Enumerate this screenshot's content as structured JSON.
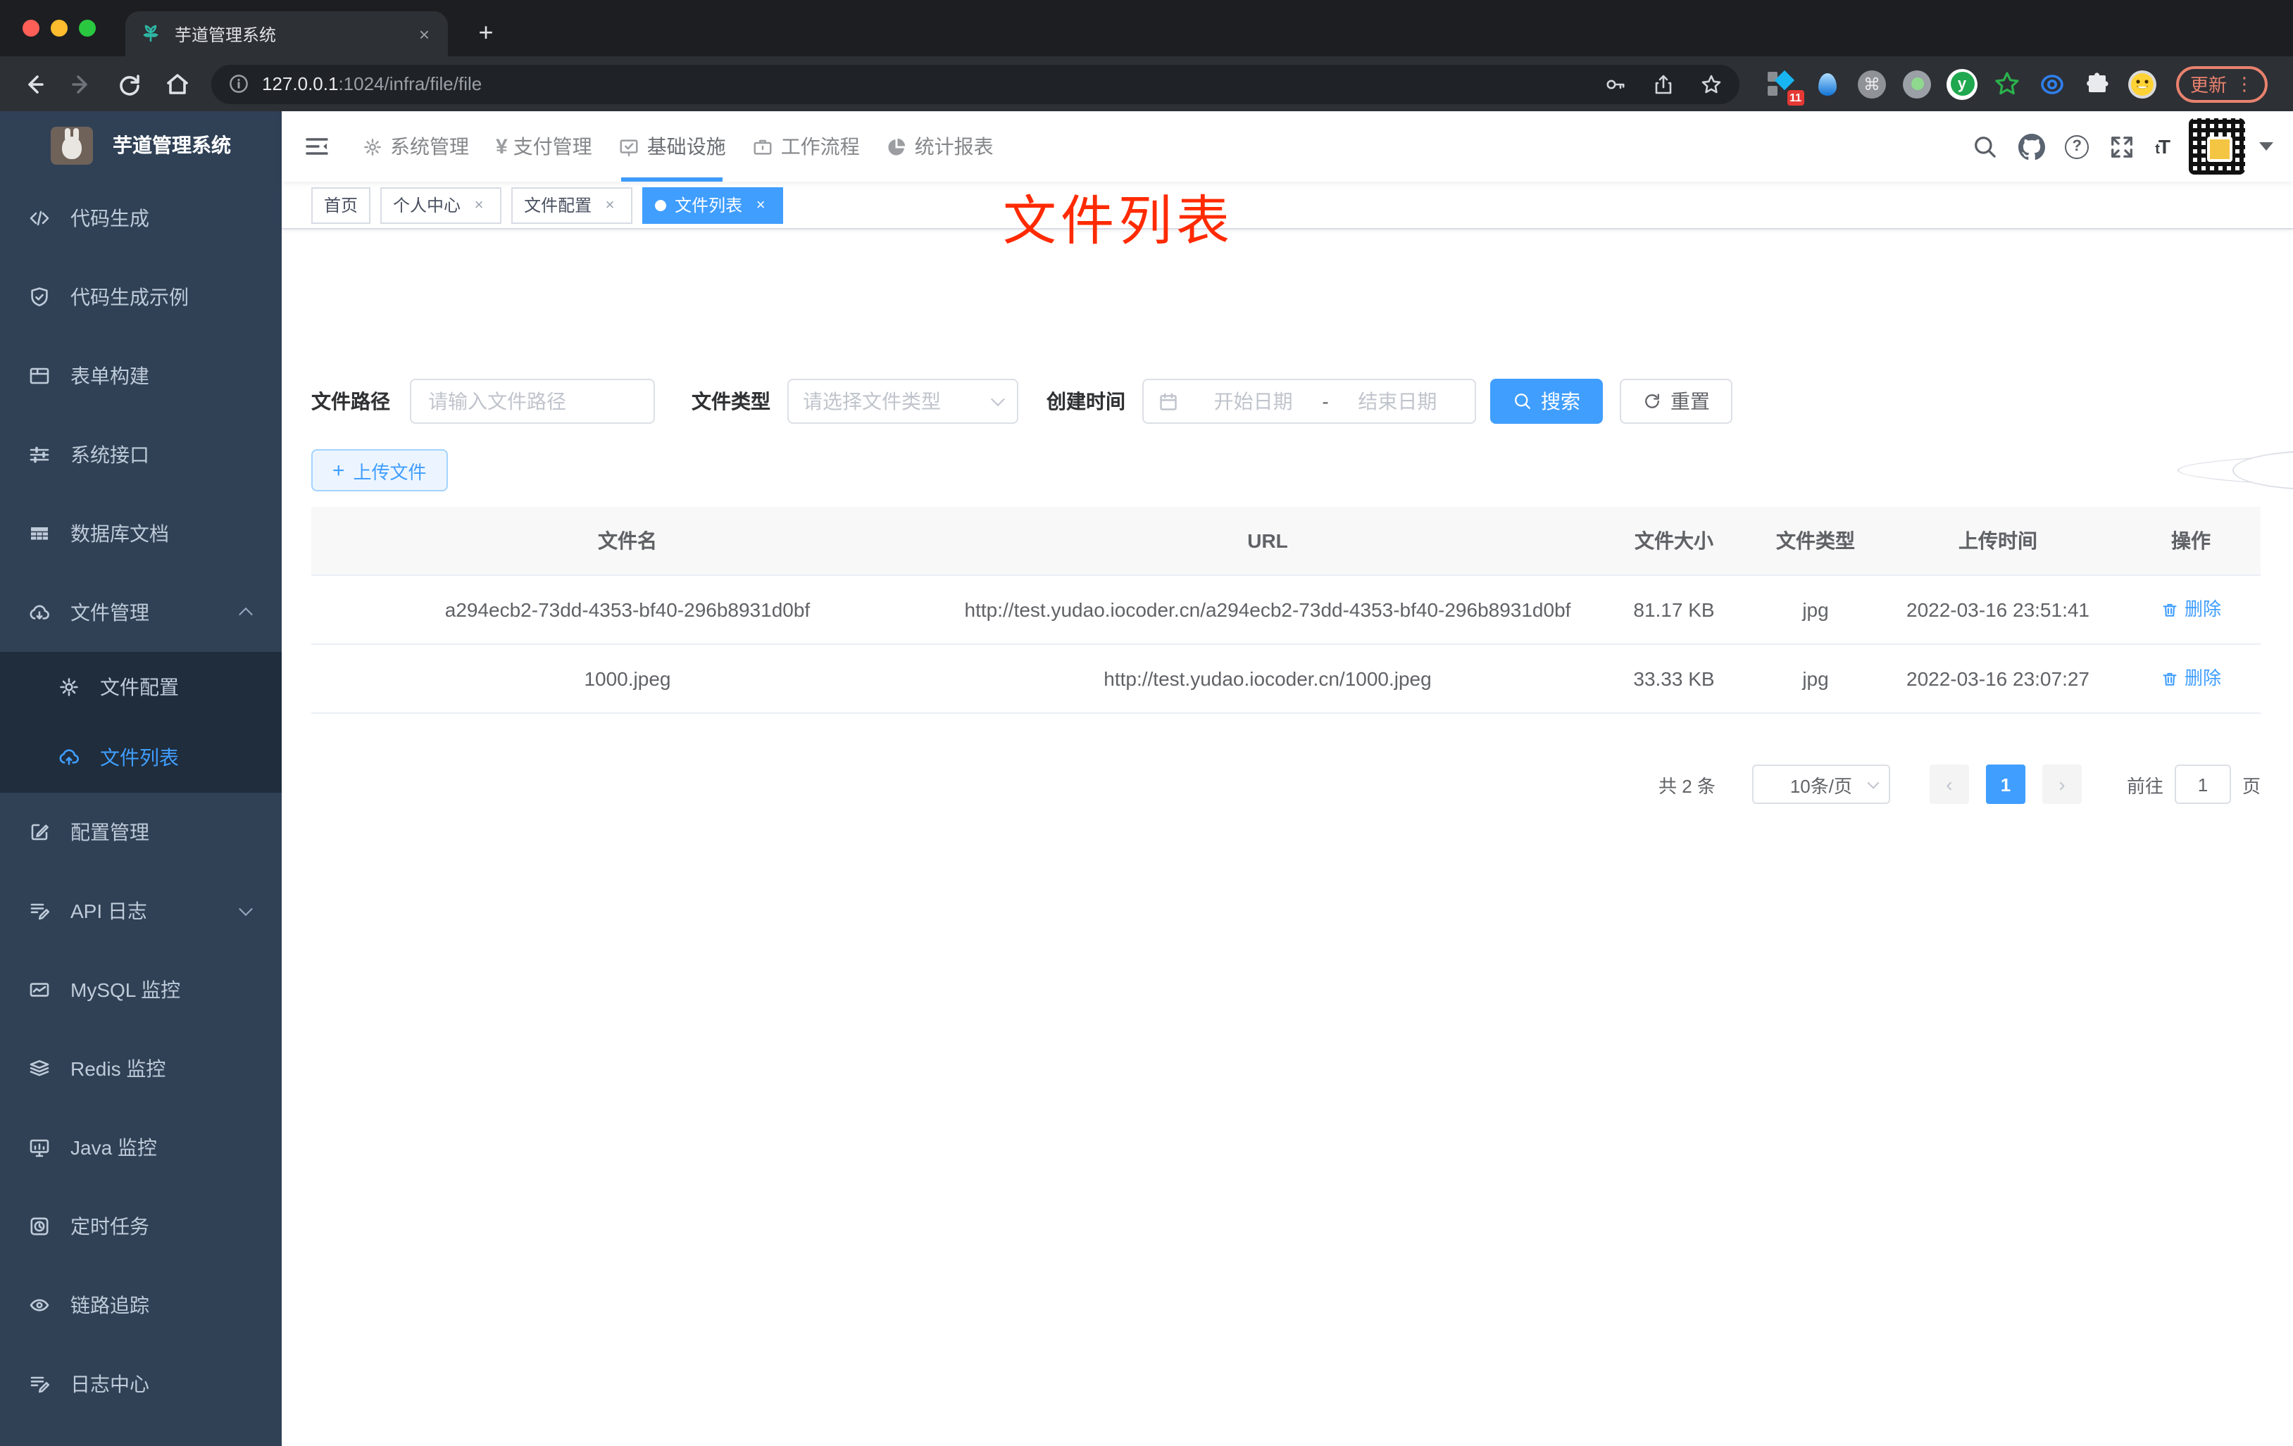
{
  "browser": {
    "tab_title": "芋道管理系统",
    "tab_close": "×",
    "new_tab": "+",
    "url_host": "127.0.0.1",
    "url_rest": ":1024/infra/file/file",
    "extension_badge": "11",
    "cmd_glyph": "⌘",
    "y_glyph": "y",
    "update_label": "更新",
    "kebab_glyph": "⋮"
  },
  "sidebar": {
    "logo_title": "芋道管理系统",
    "items": [
      {
        "label": "代码生成",
        "icon": "code-icon"
      },
      {
        "label": "代码生成示例",
        "icon": "shield-check-icon"
      },
      {
        "label": "表单构建",
        "icon": "form-icon"
      },
      {
        "label": "系统接口",
        "icon": "sliders-icon"
      },
      {
        "label": "数据库文档",
        "icon": "table-grid-icon"
      },
      {
        "label": "文件管理",
        "icon": "cloud-download-icon",
        "expanded": true
      },
      {
        "label": "文件配置",
        "icon": "gear-icon",
        "submenu": true
      },
      {
        "label": "文件列表",
        "icon": "cloud-upload-icon",
        "submenu": true,
        "active": true
      },
      {
        "label": "配置管理",
        "icon": "edit-square-icon"
      },
      {
        "label": "API 日志",
        "icon": "log-edit-icon",
        "collapsed": true
      },
      {
        "label": "MySQL 监控",
        "icon": "chart-line-icon"
      },
      {
        "label": "Redis 监控",
        "icon": "layers-icon"
      },
      {
        "label": "Java 监控",
        "icon": "monitor-icon"
      },
      {
        "label": "定时任务",
        "icon": "timer-icon"
      },
      {
        "label": "链路追踪",
        "icon": "eye-icon"
      },
      {
        "label": "日志中心",
        "icon": "log-edit-icon"
      }
    ]
  },
  "topnav": {
    "menus": [
      {
        "label": "系统管理",
        "icon": "gear-icon"
      },
      {
        "label": "支付管理",
        "icon": "yen-icon",
        "icon_glyph": "¥"
      },
      {
        "label": "基础设施",
        "icon": "monitor-check-icon",
        "active": true
      },
      {
        "label": "工作流程",
        "icon": "briefcase-icon"
      },
      {
        "label": "统计报表",
        "icon": "dashboard-icon"
      }
    ],
    "font_size_icon_text": "tT"
  },
  "tags": {
    "items": [
      {
        "label": "首页",
        "closable": false
      },
      {
        "label": "个人中心",
        "closable": true
      },
      {
        "label": "文件配置",
        "closable": true
      },
      {
        "label": "文件列表",
        "closable": true,
        "active": true
      }
    ],
    "close_glyph": "×"
  },
  "annotation": {
    "text": "文件列表",
    "color": "#ff2a00"
  },
  "filter": {
    "path_label": "文件路径",
    "path_placeholder": "请输入文件路径",
    "type_label": "文件类型",
    "type_placeholder": "请选择文件类型",
    "date_label": "创建时间",
    "date_start_placeholder": "开始日期",
    "date_separator": "-",
    "date_end_placeholder": "结束日期",
    "search_label": "搜索",
    "reset_label": "重置"
  },
  "toolbar": {
    "upload_plus": "+",
    "upload_label": "上传文件"
  },
  "table": {
    "headers": [
      "文件名",
      "URL",
      "文件大小",
      "文件类型",
      "上传时间",
      "操作"
    ],
    "rows": [
      {
        "name": "a294ecb2-73dd-4353-bf40-296b8931d0bf",
        "url": "http://test.yudao.iocoder.cn/a294ecb2-73dd-4353-bf40-296b8931d0bf",
        "size": "81.17 KB",
        "type": "jpg",
        "time": "2022-03-16 23:51:41",
        "action": "删除"
      },
      {
        "name": "1000.jpeg",
        "url": "http://test.yudao.iocoder.cn/1000.jpeg",
        "size": "33.33 KB",
        "type": "jpg",
        "time": "2022-03-16 23:07:27",
        "action": "删除"
      }
    ]
  },
  "pagination": {
    "total": "共 2 条",
    "page_size": "10条/页",
    "prev_glyph": "‹",
    "next_glyph": "›",
    "current_page": "1",
    "goto_label": "前往",
    "goto_value": "1",
    "page_unit": "页"
  },
  "colors": {
    "accent": "#409eff",
    "sidebar_bg": "#304156",
    "submenu_bg": "#1f2d3d",
    "annotation": "#ff2a00"
  }
}
